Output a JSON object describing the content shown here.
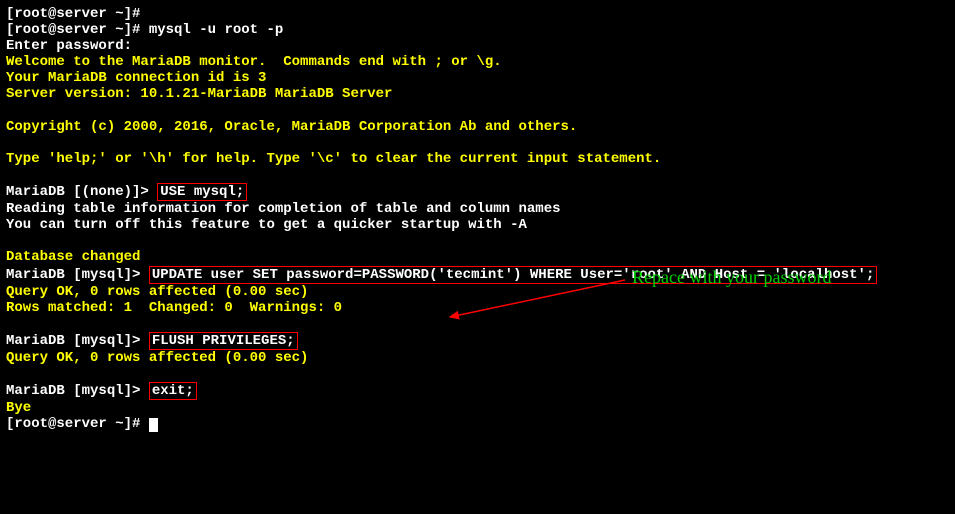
{
  "lines": {
    "l1": "[root@server ~]# ",
    "l2_prompt": "[root@server ~]# ",
    "l2_cmd": "mysql -u root -p",
    "l3": "Enter password: ",
    "l4": "Welcome to the MariaDB monitor.  Commands end with ; or \\g.",
    "l5": "Your MariaDB connection id is 3",
    "l6": "Server version: 10.1.21-MariaDB MariaDB Server",
    "l7": "Copyright (c) 2000, 2016, Oracle, MariaDB Corporation Ab and others.",
    "l8": "Type 'help;' or '\\h' for help. Type '\\c' to clear the current input statement.",
    "l9_prompt": "MariaDB [(none)]> ",
    "l9_cmd": "USE mysql;",
    "l10": "Reading table information for completion of table and column names",
    "l11": "You can turn off this feature to get a quicker startup with -A",
    "l12": "Database changed",
    "l13_prompt": "MariaDB [mysql]> ",
    "l13_cmd": "UPDATE user SET password=PASSWORD('tecmint') WHERE User='root' AND Host = 'localhost';",
    "l14": "Query OK, 0 rows affected (0.00 sec)",
    "l15": "Rows matched: 1  Changed: 0  Warnings: 0",
    "l16_prompt": "MariaDB [mysql]> ",
    "l16_cmd": "FLUSH PRIVILEGES;",
    "l17": "Query OK, 0 rows affected (0.00 sec)",
    "l18_prompt": "MariaDB [mysql]> ",
    "l18_cmd": "exit;",
    "l19": "Bye",
    "l20": "[root@server ~]# "
  },
  "annotation_text": "Repace with your password",
  "colors": {
    "bg": "#000000",
    "fg": "#ffffff",
    "highlight": "#ffff00",
    "box": "#ff0000",
    "annotation": "#00d000"
  }
}
